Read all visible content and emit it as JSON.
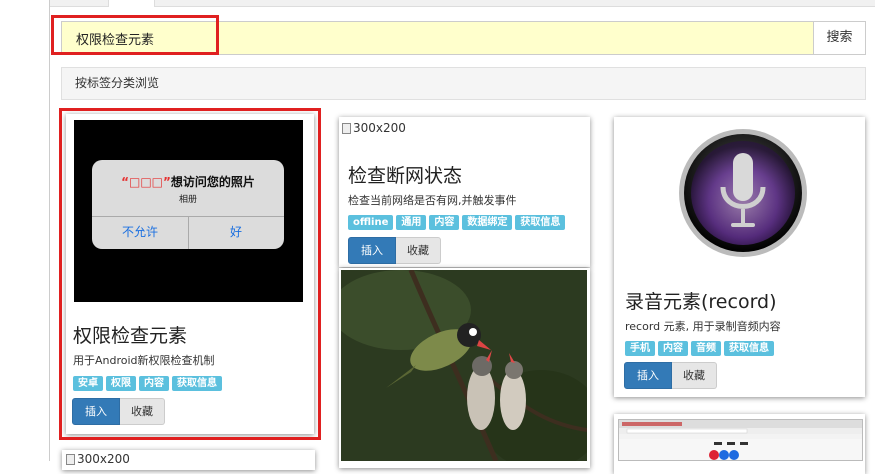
{
  "search": {
    "value": "权限检查元素",
    "button_label": "搜索"
  },
  "browse": {
    "label": "按标签分类浏览"
  },
  "cards": [
    {
      "title": "权限检查元素",
      "description": "用于Android新权限检查机制",
      "tags": [
        "安卓",
        "权限",
        "内容",
        "获取信息"
      ],
      "insert_label": "插入",
      "favorite_label": "收藏",
      "image": {
        "dialog_title_redacted": "“□□□”",
        "dialog_title_suffix": "想访问您的照片",
        "dialog_subtitle": "相册",
        "deny_label": "不允许",
        "allow_label": "好"
      }
    },
    {
      "title": "检查断网状态",
      "description": "检查当前网络是否有网,并触发事件",
      "tags": [
        "offline",
        "通用",
        "内容",
        "数据绑定",
        "获取信息"
      ],
      "insert_label": "插入",
      "favorite_label": "收藏",
      "image_alt": "300x200"
    },
    {
      "title": "录音元素(record)",
      "description": "record 元素, 用于录制音频内容",
      "tags": [
        "手机",
        "内容",
        "音频",
        "获取信息"
      ],
      "insert_label": "插入",
      "favorite_label": "收藏"
    }
  ],
  "partial_cards": [
    {
      "image_alt": "300x200"
    }
  ],
  "icons": {
    "microphone": "microphone-icon",
    "broken_image": "broken-image-icon"
  },
  "colors": {
    "tag": "#5bc0de",
    "insert_button": "#337ab7",
    "highlight": "#e02020",
    "search_bg": "#ffffcc"
  }
}
